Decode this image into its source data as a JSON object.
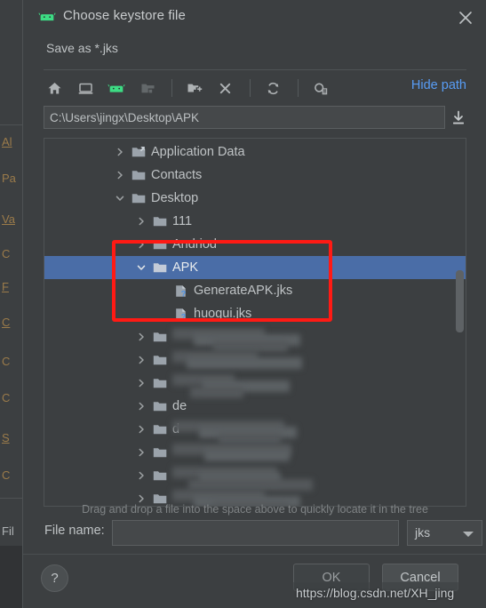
{
  "window": {
    "title": "Choose keystore file",
    "subtitle": "Save as *.jks",
    "app_icon": "android-icon",
    "close_icon": "close-icon"
  },
  "toolbar": {
    "buttons": [
      {
        "name": "home-icon",
        "tooltip": "Home"
      },
      {
        "name": "desktop-icon",
        "tooltip": "Desktop"
      },
      {
        "name": "android-icon",
        "tooltip": "Android"
      },
      {
        "name": "project-folder-icon",
        "tooltip": "Project"
      },
      {
        "name": "new-folder-icon",
        "tooltip": "New Folder"
      },
      {
        "name": "delete-icon",
        "tooltip": "Delete"
      },
      {
        "name": "refresh-icon",
        "tooltip": "Refresh"
      },
      {
        "name": "show-hidden-icon",
        "tooltip": "Show Hidden Files"
      }
    ],
    "hide_path_label": "Hide path"
  },
  "path": {
    "value": "C:\\Users\\jingx\\Desktop\\APK",
    "placeholder": "",
    "download_icon": "download-icon"
  },
  "tree": {
    "rows": [
      {
        "label": "Application Data",
        "indent": 0,
        "arrow": "right",
        "icon": "folder-link-icon",
        "selected": false,
        "blurred": false
      },
      {
        "label": "Contacts",
        "indent": 0,
        "arrow": "right",
        "icon": "folder-icon",
        "selected": false,
        "blurred": false
      },
      {
        "label": "Desktop",
        "indent": 0,
        "arrow": "down",
        "icon": "folder-icon",
        "selected": false,
        "blurred": false
      },
      {
        "label": "111",
        "indent": 1,
        "arrow": "right",
        "icon": "folder-icon",
        "selected": false,
        "blurred": false
      },
      {
        "label": "Andriod",
        "indent": 1,
        "arrow": "right",
        "icon": "folder-icon",
        "selected": false,
        "blurred": false
      },
      {
        "label": "APK",
        "indent": 1,
        "arrow": "down",
        "icon": "folder-icon",
        "selected": true,
        "blurred": false
      },
      {
        "label": "GenerateAPK.jks",
        "indent": 2,
        "arrow": "none",
        "icon": "unknown-file-icon",
        "selected": false,
        "blurred": false
      },
      {
        "label": "huogui.jks",
        "indent": 2,
        "arrow": "none",
        "icon": "unknown-file-icon",
        "selected": false,
        "blurred": false
      },
      {
        "label": "",
        "indent": 1,
        "arrow": "right",
        "icon": "folder-icon",
        "selected": false,
        "blurred": true
      },
      {
        "label": "",
        "indent": 1,
        "arrow": "right",
        "icon": "folder-icon",
        "selected": false,
        "blurred": true
      },
      {
        "label": "",
        "indent": 1,
        "arrow": "right",
        "icon": "folder-icon",
        "selected": false,
        "blurred": true
      },
      {
        "label": "de",
        "indent": 1,
        "arrow": "right",
        "icon": "folder-icon",
        "selected": false,
        "blurred": false
      },
      {
        "label": "d",
        "indent": 1,
        "arrow": "right",
        "icon": "folder-icon",
        "selected": false,
        "blurred": true
      },
      {
        "label": "",
        "indent": 1,
        "arrow": "right",
        "icon": "folder-icon",
        "selected": false,
        "blurred": true
      },
      {
        "label": "",
        "indent": 1,
        "arrow": "right",
        "icon": "folder-icon",
        "selected": false,
        "blurred": true
      },
      {
        "label": "",
        "indent": 1,
        "arrow": "right",
        "icon": "folder-icon",
        "selected": false,
        "blurred": true
      },
      {
        "label": "",
        "indent": 1,
        "arrow": "right",
        "icon": "folder-icon",
        "selected": false,
        "blurred": true
      }
    ]
  },
  "hint": "Drag and drop a file into the space above to quickly locate it in the tree",
  "filename": {
    "label": "File name:",
    "value": "",
    "placeholder": ""
  },
  "extension": {
    "value": "jks",
    "options": [
      "jks"
    ]
  },
  "footer": {
    "help_label": "?",
    "ok_label": "OK",
    "cancel_label": "Cancel"
  },
  "watermark": "https://blog.csdn.net/XH_jing",
  "background_strip": {
    "fragments": [
      "Al",
      "Pa",
      "Va",
      "C",
      "F",
      "C",
      "C",
      "C",
      "S",
      "C"
    ]
  },
  "colors": {
    "dialog_bg": "#3C3F41",
    "selection_blue": "#4A6DA7",
    "link_blue": "#589DF6",
    "android_green": "#3DDC84",
    "annotation_red": "#FF1A14",
    "text": "#BFC3C5"
  }
}
